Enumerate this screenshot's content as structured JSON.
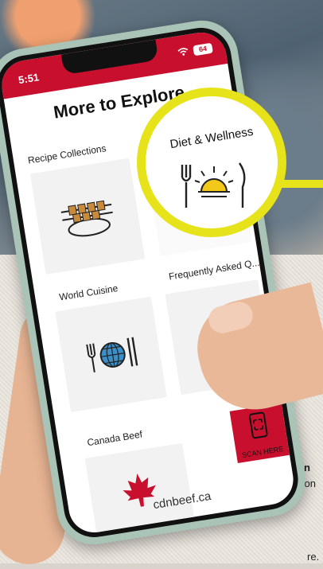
{
  "status": {
    "time": "5:51",
    "battery": "64"
  },
  "page": {
    "title": "More to Explore"
  },
  "cards": [
    {
      "label": "Recipe Collections"
    },
    {
      "label": "Diet & Wellness"
    },
    {
      "label": "World Cuisine"
    },
    {
      "label": "Frequently Asked Q..."
    },
    {
      "label": "Canada Beef"
    }
  ],
  "footer": {
    "url": "cdnbeef.ca"
  },
  "scan": {
    "label": "SCAN HERE"
  },
  "side_text": {
    "line1": "n",
    "line2": "tion",
    "line3": "re."
  },
  "colors": {
    "brand_red": "#c8102e",
    "highlight_yellow": "#e6e31a",
    "phone_frame": "#a9c3b7"
  },
  "icons": [
    "skewer-plate-icon",
    "fork-sun-knife-icon",
    "fork-globe-knife-icon",
    "maple-leaf-icon",
    "phone-scan-icon",
    "wifi-icon"
  ]
}
